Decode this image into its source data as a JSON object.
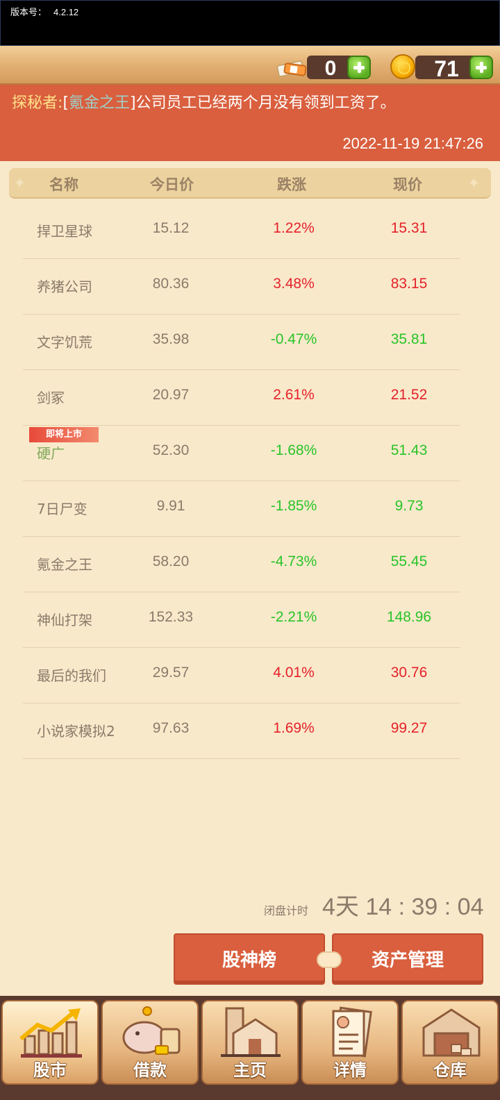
{
  "status": {
    "version_label": "版本号：",
    "version": "4.2.12"
  },
  "resources": {
    "banknotes": "0",
    "coins": "71"
  },
  "news": {
    "speaker": "探秘者",
    "stock_name": "氪金之王",
    "text": "公司员工已经两个月没有领到工资了。",
    "timestamp": "2022-11-19 21:47:26"
  },
  "table": {
    "headers": [
      "名称",
      "今日价",
      "跌涨",
      "现价"
    ],
    "rows": [
      {
        "name": "捍卫星球",
        "today": "15.12",
        "change": "1.22%",
        "now": "15.31",
        "trend": "up"
      },
      {
        "name": "养猪公司",
        "today": "80.36",
        "change": "3.48%",
        "now": "83.15",
        "trend": "up"
      },
      {
        "name": "文字饥荒",
        "today": "35.98",
        "change": "-0.47%",
        "now": "35.81",
        "trend": "down"
      },
      {
        "name": "剑冢",
        "today": "20.97",
        "change": "2.61%",
        "now": "21.52",
        "trend": "up"
      },
      {
        "name": "硬广",
        "today": "52.30",
        "change": "-1.68%",
        "now": "51.43",
        "trend": "down",
        "tag": "即将上市"
      },
      {
        "name": "7日尸变",
        "today": "9.91",
        "change": "-1.85%",
        "now": "9.73",
        "trend": "down"
      },
      {
        "name": "氪金之王",
        "today": "58.20",
        "change": "-4.73%",
        "now": "55.45",
        "trend": "down"
      },
      {
        "name": "神仙打架",
        "today": "152.33",
        "change": "-2.21%",
        "now": "148.96",
        "trend": "down"
      },
      {
        "name": "最后的我们",
        "today": "29.57",
        "change": "4.01%",
        "now": "30.76",
        "trend": "up"
      },
      {
        "name": "小说家模拟2",
        "today": "97.63",
        "change": "1.69%",
        "now": "99.27",
        "trend": "up"
      }
    ]
  },
  "countdown": {
    "label": "闭盘计时",
    "value": "4天 14 : 39 : 04"
  },
  "buttons": {
    "ranking": "股神榜",
    "assets": "资产管理"
  },
  "nav": [
    {
      "label": "股市",
      "icon": "stock-chart-icon",
      "active": true
    },
    {
      "label": "借款",
      "icon": "piggy-bank-icon"
    },
    {
      "label": "主页",
      "icon": "home-building-icon"
    },
    {
      "label": "详情",
      "icon": "document-profile-icon"
    },
    {
      "label": "仓库",
      "icon": "warehouse-icon"
    }
  ],
  "colors": {
    "up": "#e5212a",
    "down": "#28c428",
    "accent": "#d95f3e",
    "background": "#f9e9cb"
  }
}
